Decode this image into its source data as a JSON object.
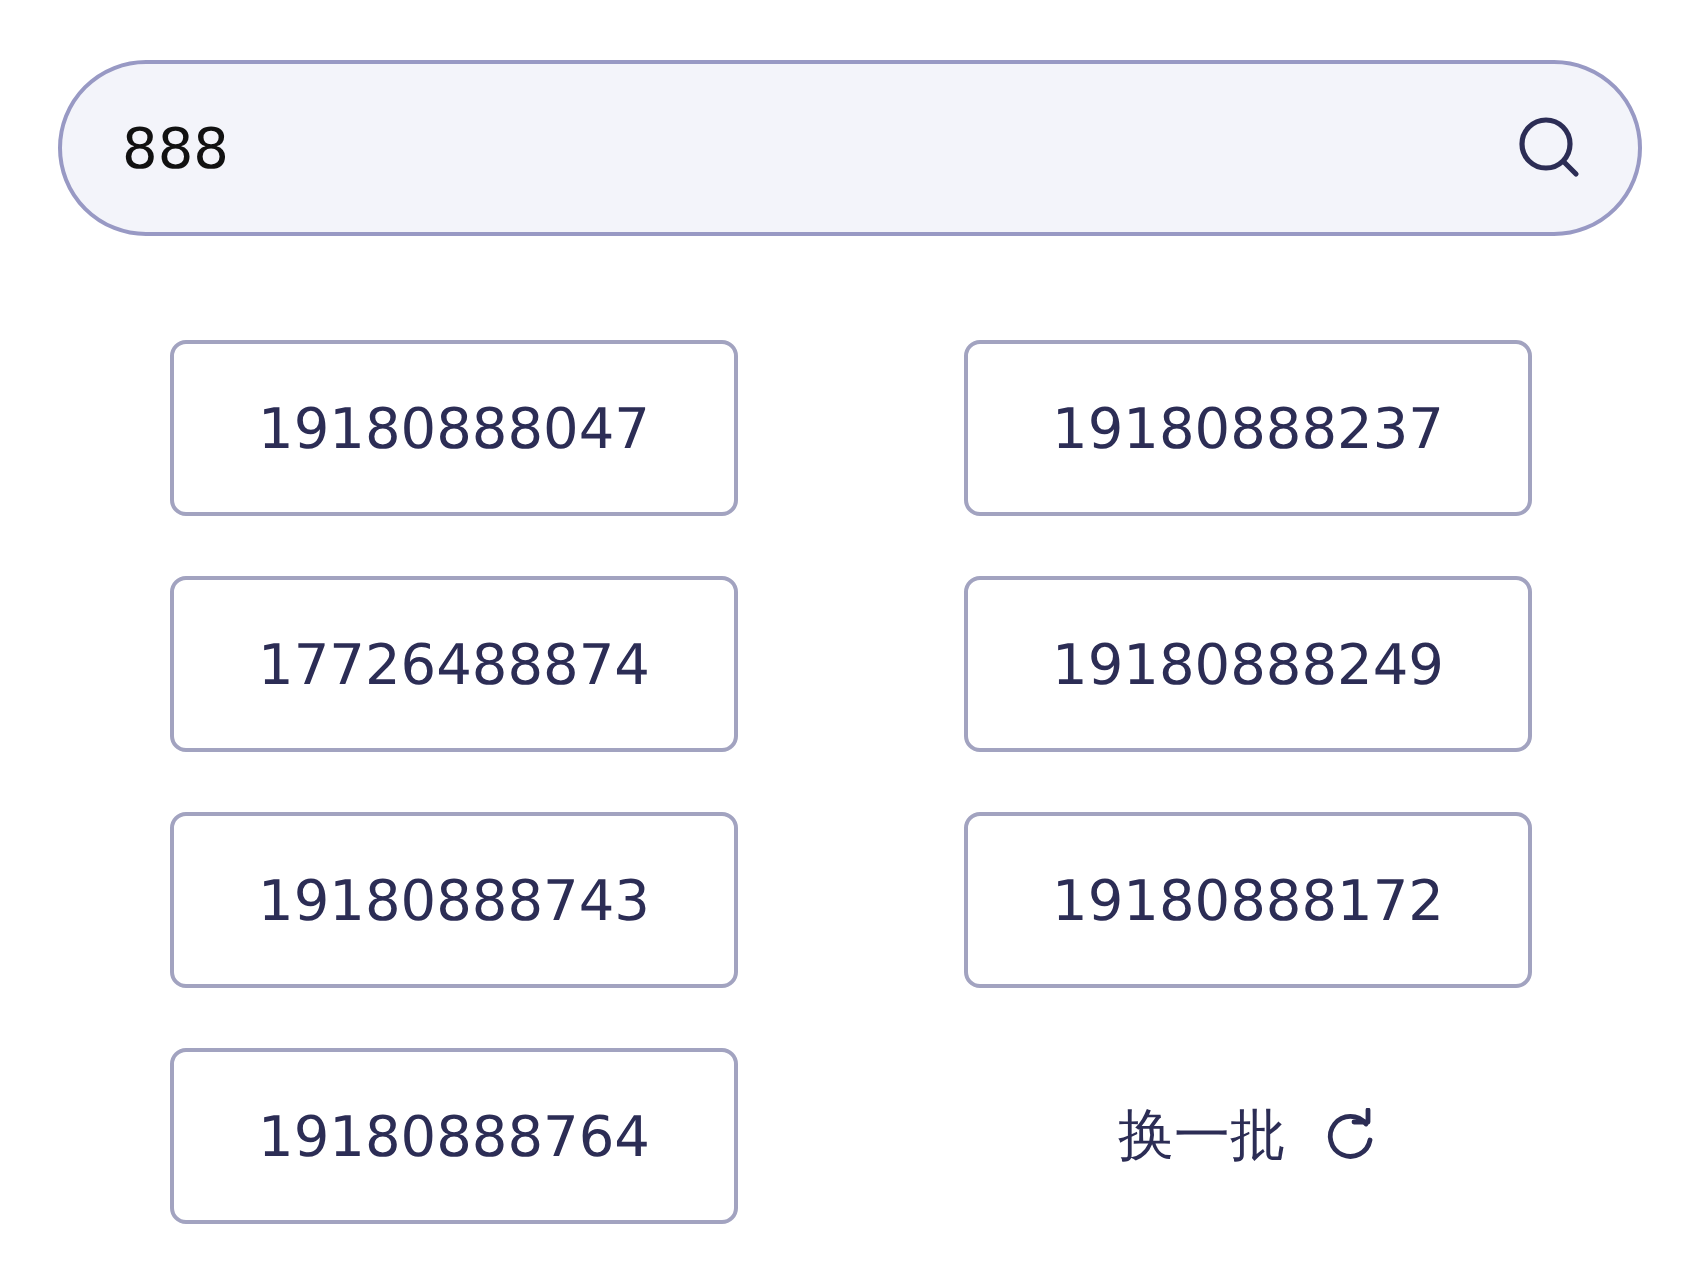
{
  "search": {
    "value": "888"
  },
  "numbers": [
    "19180888047",
    "19180888237",
    "17726488874",
    "19180888249",
    "19180888743",
    "19180888172",
    "19180888764"
  ],
  "refresh": {
    "label": "换一批"
  }
}
